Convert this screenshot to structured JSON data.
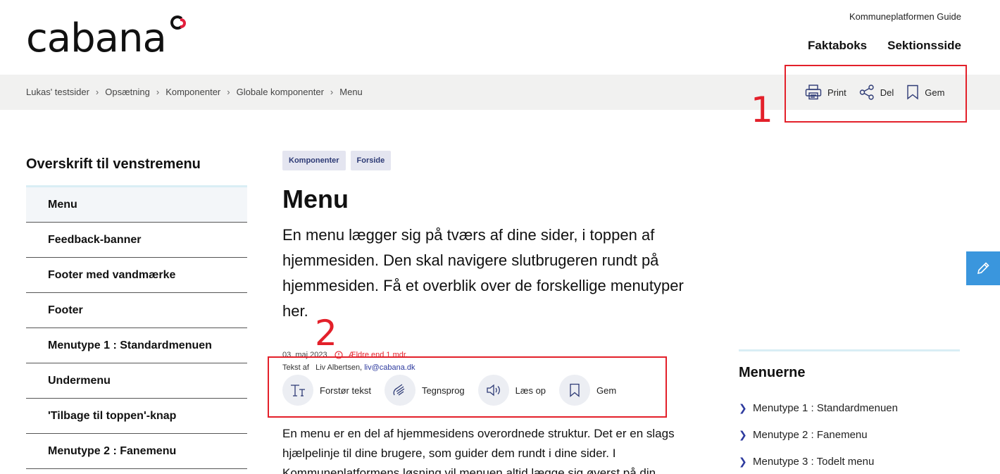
{
  "header": {
    "logo_text": "cabana",
    "top_link": "Kommuneplatformen Guide",
    "nav": [
      "Faktaboks",
      "Sektionsside"
    ]
  },
  "breadcrumb": [
    "Lukas' testsider",
    "Opsætning",
    "Komponenter",
    "Globale komponenter",
    "Menu"
  ],
  "tools": {
    "print": "Print",
    "share": "Del",
    "save": "Gem"
  },
  "annotations": {
    "one": "1",
    "two": "2",
    "color": "#e3202a"
  },
  "sidebar": {
    "title": "Overskrift til venstremenu",
    "items": [
      "Menu",
      "Feedback-banner",
      "Footer med vandmærke",
      "Footer",
      "Menutype 1 : Standardmenuen",
      "Undermenu",
      "'Tilbage til toppen'-knap",
      "Menutype 2 : Fanemenu"
    ],
    "active_index": 0
  },
  "article": {
    "tags": [
      "Komponenter",
      "Forside"
    ],
    "title": "Menu",
    "lead": "En menu lægger sig på tværs af dine sider, i toppen af hjemmesiden. Den skal navigere slutbrugeren rundt på hjemmesiden. Få et overblik over de forskellige menutyper her.",
    "date": "03. maj 2023",
    "age_warning": "Ældre end 1 mdr.",
    "author_label": "Tekst af",
    "author_name": "Liv Albertsen,",
    "author_email": "liv@cabana.dk",
    "actions": {
      "enlarge": "Forstør tekst",
      "sign": "Tegnsprog",
      "read": "Læs op",
      "save": "Gem"
    },
    "body": "En menu er en del af hjemmesidens overordnede struktur. Det er en slags hjælpelinje til dine brugere, som guider dem rundt i dine sider. I Kommuneplatformens løsning vil menuen altid lægge sig øverst på din"
  },
  "right_panel": {
    "title": "Menuerne",
    "items": [
      "Menutype 1 : Standardmenuen",
      "Menutype 2 : Fanemenu",
      "Menutype 3 : Todelt menu"
    ]
  },
  "colors": {
    "accent_blue": "#2d3a9e",
    "fab_blue": "#3a96dd",
    "brand_red": "#e31f3c",
    "crumb_bg": "#f1f1f0"
  }
}
